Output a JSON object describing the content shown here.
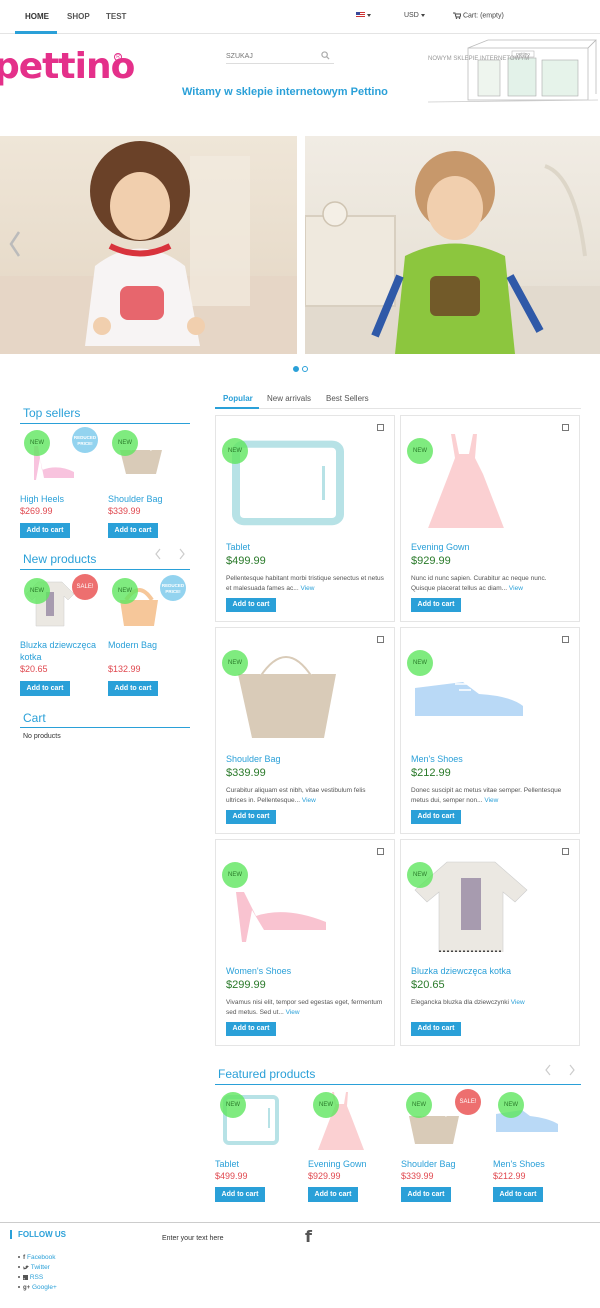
{
  "nav": {
    "items": [
      "HOME",
      "SHOP",
      "TEST"
    ],
    "currency": "USD",
    "cart": "Cart: (empty)"
  },
  "header": {
    "logo": "pettino",
    "search_placeholder": "SZUKAJ",
    "welcome": "Witamy w sklepie internetowym Pettino",
    "sketch_text": "NOWYM SKLEPIE INTERNETOWYM",
    "sketch_sign": "pettino"
  },
  "slider": {
    "slides": 2,
    "active": 1
  },
  "sidebar": {
    "top_sellers": {
      "title": "Top sellers",
      "products": [
        {
          "name": "High Heels",
          "price": "$269.99",
          "badges": [
            "NEW",
            "REDUCED PRICE!"
          ],
          "button": "Add to cart"
        },
        {
          "name": "Shoulder Bag",
          "price": "$339.99",
          "badges": [
            "NEW"
          ],
          "button": "Add to cart"
        }
      ]
    },
    "new_products": {
      "title": "New products",
      "products": [
        {
          "name": "Bluzka dziewczęca kotka",
          "price": "$20.65",
          "badges": [
            "NEW",
            "SALE!"
          ],
          "button": "Add to cart"
        },
        {
          "name": "Modern Bag",
          "price": "$132.99",
          "badges": [
            "NEW",
            "REDUCED PRICE!"
          ],
          "button": "Add to cart"
        }
      ]
    },
    "cart": {
      "title": "Cart",
      "empty": "No products"
    }
  },
  "tabs": [
    "Popular",
    "New arrivals",
    "Best Sellers"
  ],
  "products": [
    {
      "name": "Tablet",
      "price": "$499.99",
      "desc": "Pellentesque habitant morbi tristique senectus et netus et malesuada fames ac...",
      "view": "View",
      "badge": "NEW",
      "button": "Add to cart"
    },
    {
      "name": "Evening Gown",
      "price": "$929.99",
      "desc": "Nunc id nunc sapien. Curabitur ac neque nunc. Quisque placerat tellus ac diam...",
      "view": "View",
      "badge": "NEW",
      "button": "Add to cart"
    },
    {
      "name": "Shoulder Bag",
      "price": "$339.99",
      "desc": "Curabitur aliquam est nibh, vitae vestibulum felis ultrices in. Pellentesque...",
      "view": "View",
      "badge": "NEW",
      "button": "Add to cart"
    },
    {
      "name": "Men's Shoes",
      "price": "$212.99",
      "desc": "Donec suscipit ac metus vitae semper. Pellentesque metus dui, semper non...",
      "view": "View",
      "badge": "NEW",
      "button": "Add to cart"
    },
    {
      "name": "Women's Shoes",
      "price": "$299.99",
      "desc": "Vivamus nisi elit, tempor sed egestas eget, fermentum sed metus. Sed ut...",
      "view": "View",
      "badge": "NEW",
      "button": "Add to cart"
    },
    {
      "name": "Bluzka dziewczęca kotka",
      "price": "$20.65",
      "desc": "Elegancka bluzka dla dziewczynki",
      "view": "View",
      "badge": "NEW",
      "button": "Add to cart"
    }
  ],
  "featured": {
    "title": "Featured products",
    "products": [
      {
        "name": "Tablet",
        "price": "$499.99",
        "badges": [
          "NEW"
        ],
        "button": "Add to cart"
      },
      {
        "name": "Evening Gown",
        "price": "$929.99",
        "badges": [
          "NEW"
        ],
        "button": "Add to cart"
      },
      {
        "name": "Shoulder Bag",
        "price": "$339.99",
        "badges": [
          "NEW",
          "SALE!"
        ],
        "button": "Add to cart"
      },
      {
        "name": "Men's Shoes",
        "price": "$212.99",
        "badges": [
          "NEW"
        ],
        "button": "Add to cart"
      }
    ]
  },
  "footer": {
    "follow": "FOLLOW US",
    "links": [
      "Facebook",
      "Twitter",
      "RSS",
      "Google+"
    ],
    "text": "Enter your text here",
    "fb_glyph": "f"
  },
  "colors": {
    "accent": "#2aa0d8",
    "brand": "#e4308a",
    "price_red": "#e0484f",
    "price_green": "#2a7a2a",
    "new_badge": "#5fe65f"
  }
}
